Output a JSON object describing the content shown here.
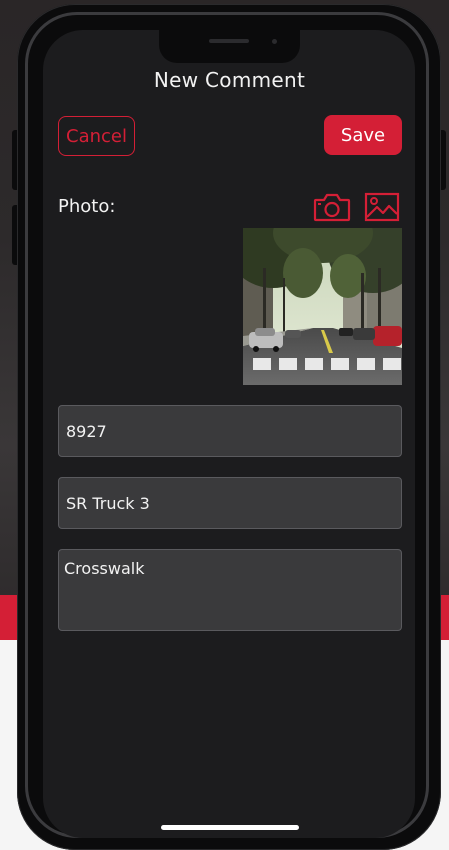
{
  "header": {
    "title": "New Comment"
  },
  "toolbar": {
    "cancel_label": "Cancel",
    "save_label": "Save"
  },
  "photo": {
    "label": "Photo:",
    "camera_icon": "camera-icon",
    "gallery_icon": "image-gallery-icon"
  },
  "form": {
    "field_1_value": "8927",
    "field_2_value": "SR Truck 3",
    "comment_value": "Crosswalk"
  },
  "colors": {
    "accent": "#d41f36",
    "screen_bg": "#1c1c1e",
    "field_bg": "#3a3a3c"
  }
}
